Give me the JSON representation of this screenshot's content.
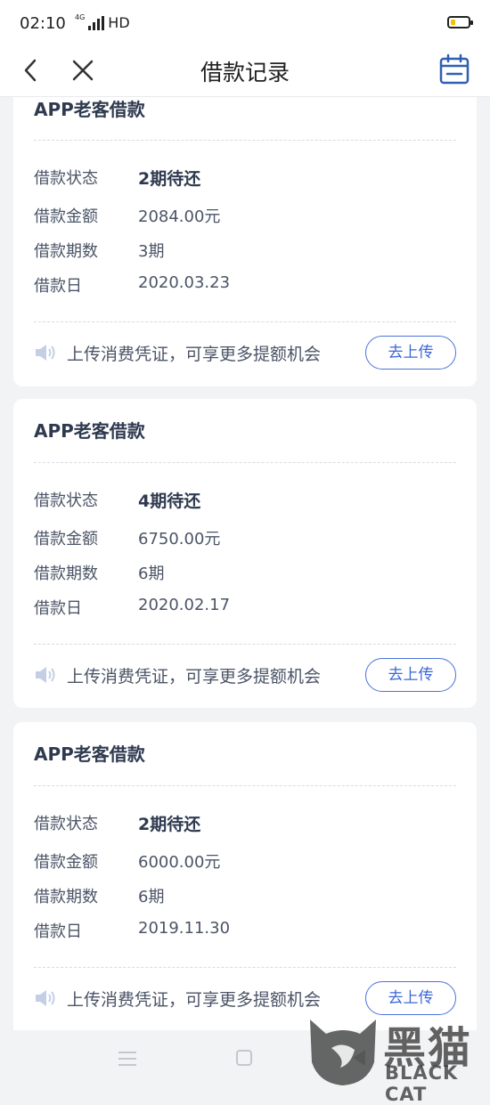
{
  "status_bar": {
    "time": "02:10",
    "network": "4G",
    "signal_label": "HD",
    "battery_color": "#f2c200"
  },
  "nav": {
    "title": "借款记录"
  },
  "loans": [
    {
      "title": "APP老客借款",
      "status_label": "借款状态",
      "status": "2期待还",
      "amount_label": "借款金额",
      "amount": "2084.00元",
      "term_label": "借款期数",
      "term": "3期",
      "date_label": "借款日",
      "date": "2020.03.23",
      "notice": "上传消费凭证，可享更多提额机会",
      "upload_label": "去上传"
    },
    {
      "title": "APP老客借款",
      "status_label": "借款状态",
      "status": "4期待还",
      "amount_label": "借款金额",
      "amount": "6750.00元",
      "term_label": "借款期数",
      "term": "6期",
      "date_label": "借款日",
      "date": "2020.02.17",
      "notice": "上传消费凭证，可享更多提额机会",
      "upload_label": "去上传"
    },
    {
      "title": "APP老客借款",
      "status_label": "借款状态",
      "status": "2期待还",
      "amount_label": "借款金额",
      "amount": "6000.00元",
      "term_label": "借款期数",
      "term": "6期",
      "date_label": "借款日",
      "date": "2019.11.30",
      "notice": "上传消费凭证，可享更多提额机会",
      "upload_label": "去上传"
    }
  ],
  "watermark": {
    "text_cn": "黑猫",
    "text_en": "BLACK CAT"
  },
  "colors": {
    "accent": "#4a73d9",
    "background": "#f2f3f5"
  }
}
